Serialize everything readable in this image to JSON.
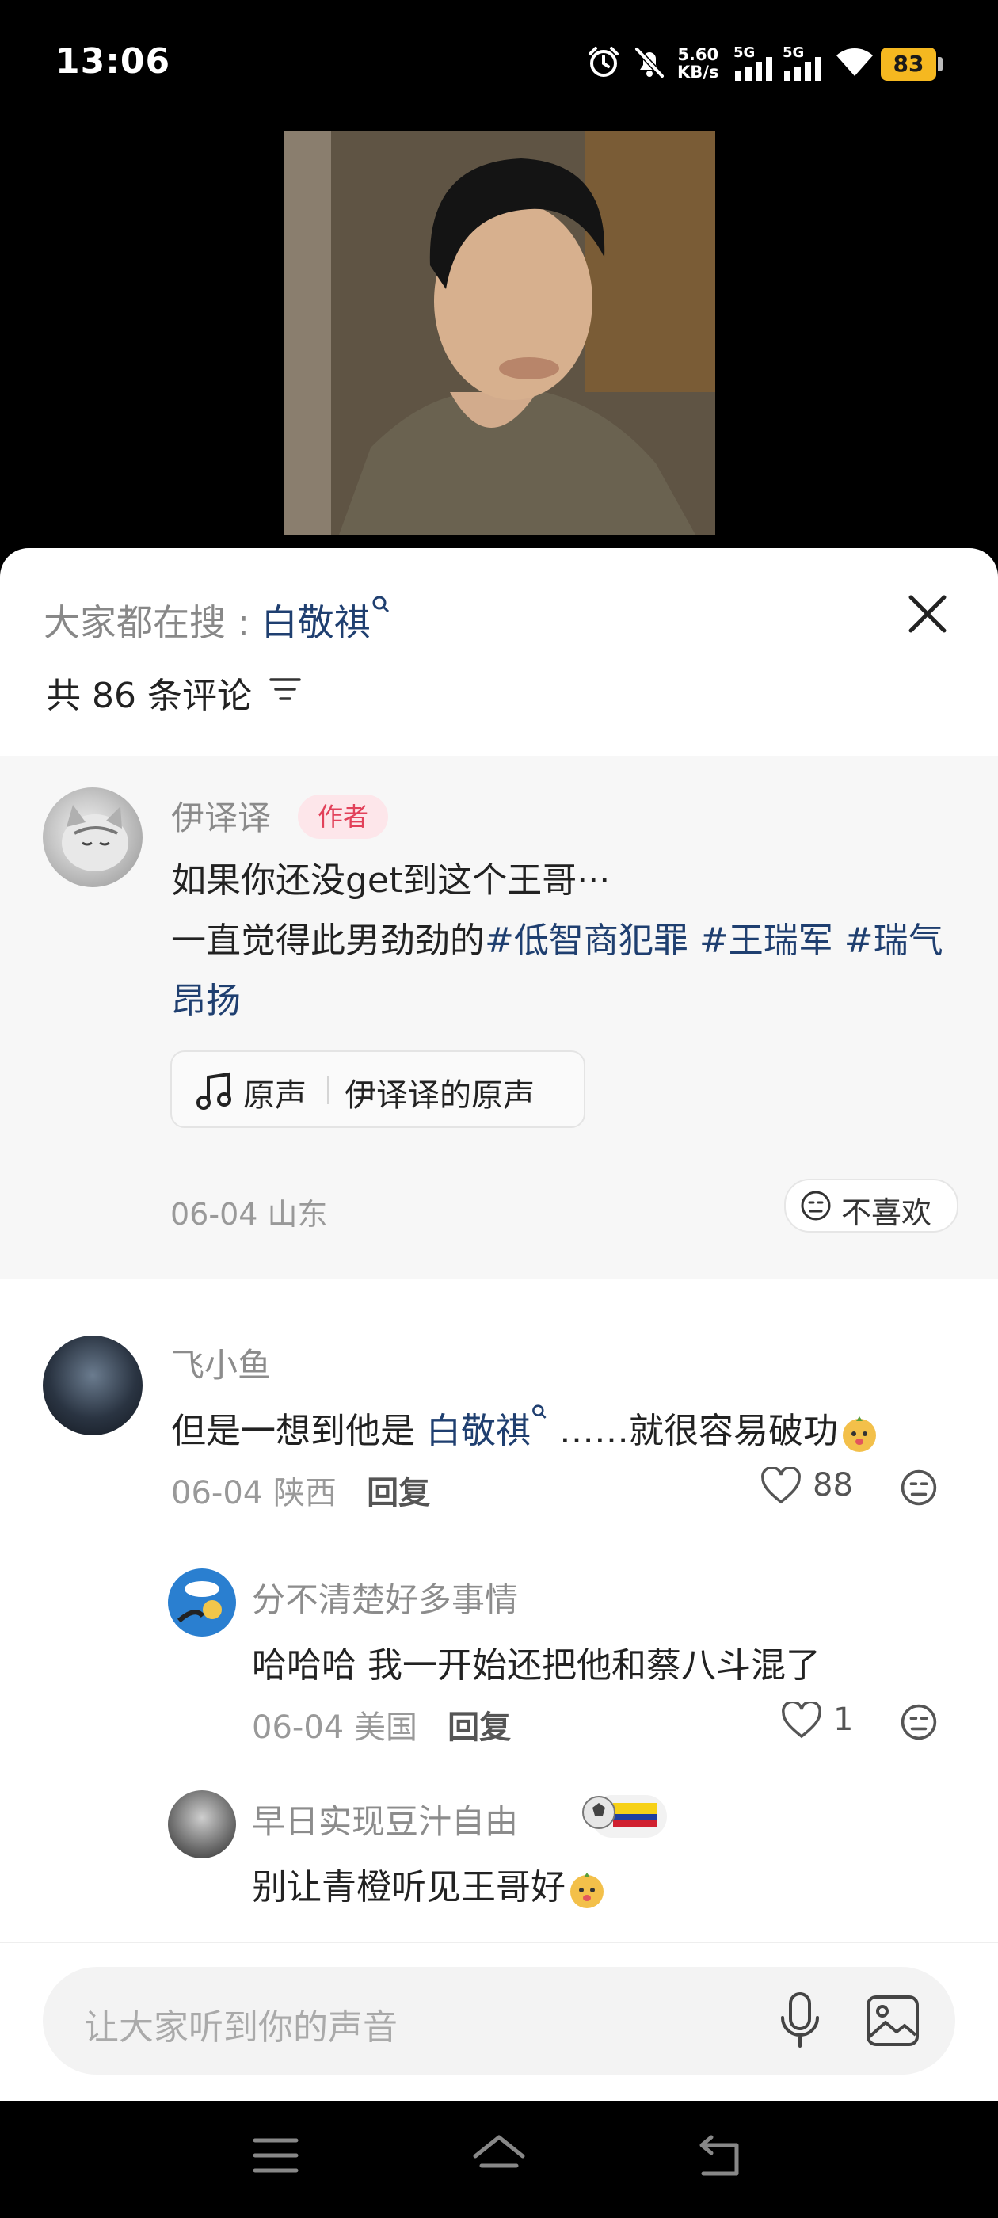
{
  "status_bar": {
    "time": "13:06",
    "net_speed_value": "5.60",
    "net_speed_unit": "KB/s",
    "signal_1_label": "5G",
    "signal_2_label": "5G",
    "battery": "83",
    "icons": [
      "alarm-icon",
      "mute-icon",
      "signal-icon",
      "signal-icon",
      "wifi-icon",
      "battery-icon"
    ]
  },
  "sheet": {
    "search_prefix": "大家都在搜 :",
    "search_keyword": "白敬祺",
    "comment_count": "共 86 条评论"
  },
  "author_post": {
    "name": "伊译译",
    "badge": "作者",
    "line1": "如果你还没get到这个王哥···",
    "line2_prefix": "一直觉得此男劲劲的",
    "tags": [
      "#低智商犯罪",
      "#王瑞军",
      "#瑞气昂扬"
    ],
    "music_label": "原声",
    "music_title": "伊译译的原声",
    "meta": "06-04 山东",
    "dislike_label": "不喜欢"
  },
  "comments": [
    {
      "name": "飞小鱼",
      "text_before": "但是一想到他是 ",
      "keyword": "白敬祺",
      "text_after": " ……就很容易破功",
      "meta": "06-04 陕西",
      "reply_label": "回复",
      "likes": "88"
    }
  ],
  "replies": [
    {
      "name": "分不清楚好多事情",
      "text": "哈哈哈 我一开始还把他和蔡八斗混了",
      "meta": "06-04 美国",
      "reply_label": "回复",
      "likes": "1"
    },
    {
      "name": "早日实现豆汁自由",
      "text": "别让青橙听见王哥好"
    }
  ],
  "input": {
    "placeholder": "让大家听到你的声音"
  },
  "colors": {
    "link": "#1f3f70",
    "author_badge": "#e2415a",
    "battery": "#f5b820"
  }
}
